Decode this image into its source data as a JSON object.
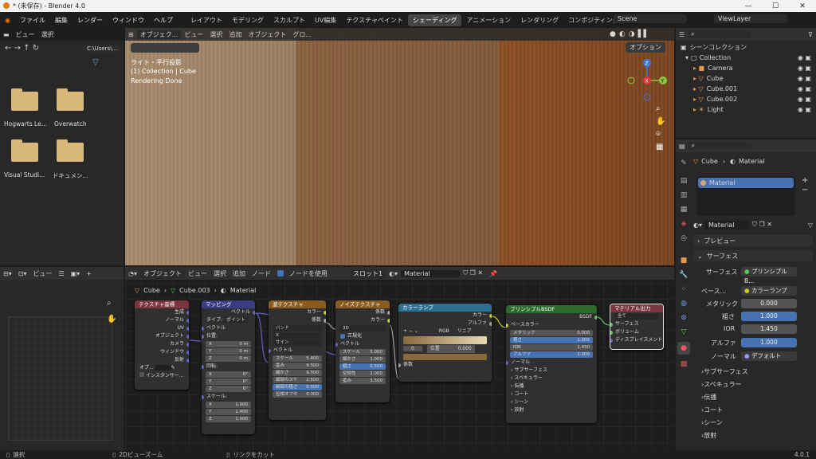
{
  "window": {
    "title": "* (未保存) - Blender 4.0",
    "min": "—",
    "max": "☐",
    "close": "✕"
  },
  "menu": [
    "ファイル",
    "編集",
    "レンダー",
    "ウィンドウ",
    "ヘルプ"
  ],
  "workspaces": [
    "レイアウト",
    "モデリング",
    "スカルプト",
    "UV編集",
    "テクスチャペイント",
    "シェーディング",
    "アニメーション",
    "レンダリング",
    "コンポジティング"
  ],
  "active_workspace": "シェーディング",
  "scene": "Scene",
  "view_layer": "ViewLayer",
  "filebrowser": {
    "menu": [
      "ビュー",
      "選択"
    ],
    "path": "C:\\Users\\...",
    "items": [
      "Hogwarts Le...",
      "Overwatch",
      "Visual Studi...",
      "ドキュメン..."
    ]
  },
  "viewport": {
    "header": [
      "オブジェク...",
      "ビュー",
      "選択",
      "追加",
      "オブジェクト",
      "グロ..."
    ],
    "options": "オプション",
    "info": [
      "ライト・平行投影",
      "(1) Collection | Cube",
      "Rendering Done"
    ],
    "gizmo": {
      "x": "X",
      "y": "Y",
      "z": "Z"
    }
  },
  "outliner": {
    "title": "シーンコレクション",
    "items": [
      {
        "name": "Collection",
        "indent": 1
      },
      {
        "name": "Camera",
        "indent": 2
      },
      {
        "name": "Cube",
        "indent": 2
      },
      {
        "name": "Cube.001",
        "indent": 2
      },
      {
        "name": "Cube.002",
        "indent": 2
      },
      {
        "name": "Light",
        "indent": 2
      }
    ]
  },
  "properties": {
    "breadcrumb": [
      "Cube",
      "Material"
    ],
    "slot": "Material",
    "material_name": "Material",
    "preview": "プレビュー",
    "surface_panel": "サーフェス",
    "surface": {
      "label": "サーフェス",
      "value": "プリンシプルB..."
    },
    "base_color": {
      "label": "ベース...",
      "value": "カラーランプ"
    },
    "metallic": {
      "label": "メタリック",
      "value": "0.000"
    },
    "roughness": {
      "label": "粗さ",
      "value": "1.000"
    },
    "ior": {
      "label": "IOR",
      "value": "1.450"
    },
    "alpha": {
      "label": "アルファ",
      "value": "1.000"
    },
    "normal": {
      "label": "ノーマル",
      "value": "デフォルト"
    },
    "subpanels": [
      "サブサーフェス",
      "スペキュラー",
      "伝播",
      "コート",
      "シーン",
      "放射"
    ]
  },
  "node_editor": {
    "header": [
      "オブジェクト",
      "ビュー",
      "選択",
      "追加",
      "ノード"
    ],
    "use_nodes": "ノードを使用",
    "slot": "スロット1",
    "material": "Material",
    "breadcrumb": [
      "Cube",
      "Cube.003",
      "Material"
    ],
    "nodes": {
      "texcoord": {
        "title": "テクスチャ座標",
        "outputs": [
          "生成",
          "ノーマル",
          "UV",
          "オブジェクト",
          "カメラ",
          "ウィンドウ",
          "反射"
        ],
        "obj": "オブ...",
        "instancer": "インスタンサー..."
      },
      "mapping": {
        "title": "マッピング",
        "output": "ベクトル",
        "type_label": "タイプ:",
        "type": "ポイント",
        "vector": "ベクトル",
        "location": "位置:",
        "loc": [
          [
            "X",
            "0 m"
          ],
          [
            "Y",
            "0 m"
          ],
          [
            "Z",
            "0 m"
          ]
        ],
        "rotation": "回転:",
        "rot": [
          [
            "X",
            "0°"
          ],
          [
            "Y",
            "0°"
          ],
          [
            "Z",
            "0°"
          ]
        ],
        "scale": "スケール:",
        "scl": [
          [
            "X",
            "1.000"
          ],
          [
            "Y",
            "1.400"
          ],
          [
            "Z",
            "1.000"
          ]
        ]
      },
      "wave": {
        "title": "波テクスチャ",
        "outputs": [
          "カラー",
          "係数"
        ],
        "type": "バンド",
        "axis": "X",
        "profile": "サイン",
        "vector": "ベクトル",
        "fields": [
          [
            "スケール",
            "5.400"
          ],
          [
            "歪み",
            "9.500"
          ],
          [
            "細かさ",
            "9.500"
          ],
          [
            "細部のスケ",
            "2.500"
          ],
          [
            "細部の粗さ",
            "0.500"
          ],
          [
            "位相オフセ",
            "0.000"
          ]
        ]
      },
      "noise": {
        "title": "ノイズテクスチャ",
        "outputs": [
          "係数",
          "カラー"
        ],
        "dim": "3D",
        "normalize": "正規化",
        "vector": "ベクトル",
        "fields": [
          [
            "スケール",
            "5.000"
          ],
          [
            "細かさ",
            "1.000"
          ],
          [
            "粗さ",
            "0.500"
          ],
          [
            "空隙性",
            "2.000"
          ],
          [
            "歪み",
            "3.500"
          ]
        ]
      },
      "ramp": {
        "title": "カラーランプ",
        "outputs": [
          "カラー",
          "アルファ"
        ],
        "mode": "RGB",
        "interp": "リニア",
        "index": "0",
        "pos_label": "位置",
        "pos": "0.000",
        "fac": "係数"
      },
      "bsdf": {
        "title": "プリンシプルBSDF",
        "output": "BSDF",
        "inputs": [
          "ベースカラー"
        ],
        "fields": [
          [
            "メタリック",
            "0.000"
          ],
          [
            "粗さ",
            "1.000"
          ],
          [
            "IOR",
            "1.450"
          ],
          [
            "アルファ",
            "1.000"
          ]
        ],
        "normal": "ノーマル",
        "subs": [
          "サブサーフェス",
          "スペキュラー",
          "伝播",
          "コート",
          "シーン",
          "放射"
        ]
      },
      "output": {
        "title": "マテリアル出力",
        "target": "全て",
        "inputs": [
          "サーフェス",
          "ボリューム",
          "ディスプレイスメント"
        ]
      }
    }
  },
  "uv_editor": {
    "header": [
      "ビュー"
    ]
  },
  "status": {
    "select": "選択",
    "zoom": "2Dビューズーム",
    "cut": "リンクをカット",
    "version": "4.0.1"
  },
  "colors": {
    "accent": "#4772b3",
    "active_ws": "#454545",
    "ramp_light": "#e8d9b8",
    "ramp_dark": "#8a6a3c"
  }
}
